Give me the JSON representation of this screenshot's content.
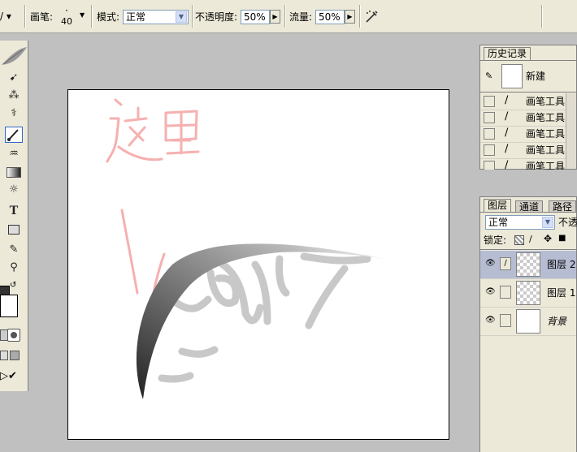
{
  "options_bar": {
    "brush_label": "画笔:",
    "brush_size": "40",
    "mode_label": "模式:",
    "mode_value": "正常",
    "opacity_label": "不透明度:",
    "opacity_value": "50%",
    "flow_label": "流量:",
    "flow_value": "50%"
  },
  "toolbox": {
    "tools": [
      "move-icon",
      "magic-wand-icon",
      "healing-brush-icon",
      "brush-icon",
      "history-brush-icon",
      "gradient-icon",
      "smudge-icon",
      "type-icon",
      "rectangle-shape-icon",
      "eyedropper-icon",
      "zoom-icon"
    ],
    "selected": "brush-icon",
    "type_tool_glyph": "T"
  },
  "canvas": {
    "annotation_text": "这里"
  },
  "history_panel": {
    "tab_label": "历史记录",
    "snapshot_label": "新建",
    "items": [
      "画笔工具",
      "画笔工具",
      "画笔工具",
      "画笔工具",
      "画笔工具"
    ]
  },
  "layers_panel": {
    "tabs": [
      "图层",
      "通道",
      "路径"
    ],
    "blend_mode": "正常",
    "opacity_label": "不透",
    "lock_label": "锁定:",
    "layers": [
      {
        "name": "图层 2",
        "selected": true
      },
      {
        "name": "图层 1",
        "selected": false
      },
      {
        "name": "背景",
        "selected": false
      }
    ]
  },
  "colors": {
    "ui_bg": "#ece9d8",
    "workspace_bg": "#c0c0c0",
    "selection_blue": "#316ac5",
    "annotation_pink": "#f4a8a8"
  }
}
